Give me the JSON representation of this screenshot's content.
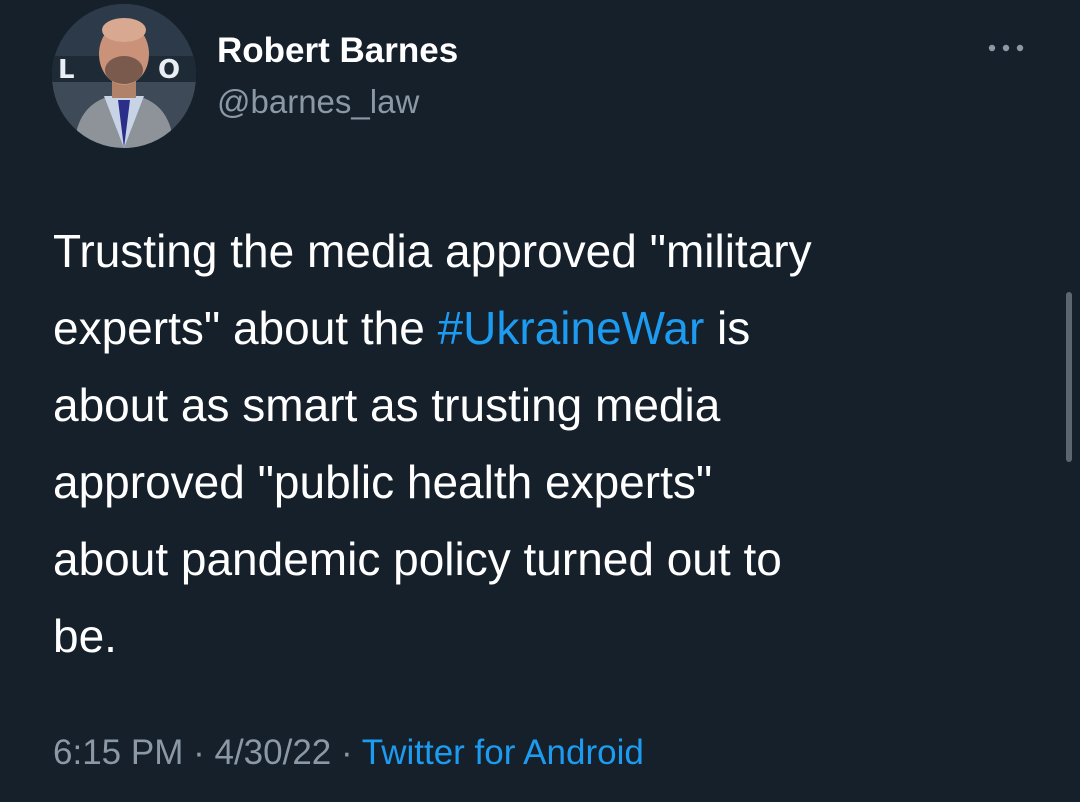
{
  "tweet": {
    "author": {
      "display_name": "Robert Barnes",
      "handle": "@barnes_law",
      "avatar_icon": "profile-photo"
    },
    "more_icon": "more-horizontal-icon",
    "text": {
      "line1": "Trusting the media approved \"military",
      "line2_before": "experts\" about the ",
      "hashtag": "#UkraineWar",
      "line2_after": " is",
      "line3": "about as smart as trusting media",
      "line4": "approved \"public health experts\"",
      "line5": "about pandemic policy turned out to",
      "line6": "be."
    },
    "time": "6:15 PM",
    "date": "4/30/22",
    "separator": "·",
    "source": "Twitter for Android"
  },
  "colors": {
    "background": "#15202b",
    "primary_text": "#ffffff",
    "secondary_text": "#8b98a5",
    "link": "#1d9bf0"
  }
}
